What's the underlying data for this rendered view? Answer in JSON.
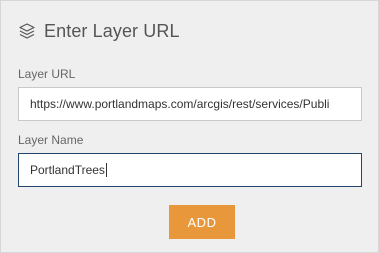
{
  "header": {
    "title": "Enter Layer URL",
    "icon": "layers-icon"
  },
  "form": {
    "url_label": "Layer URL",
    "url_value": "https://www.portlandmaps.com/arcgis/rest/services/Publi",
    "name_label": "Layer Name",
    "name_value": "PortlandTrees"
  },
  "actions": {
    "add_label": "ADD"
  },
  "colors": {
    "accent": "#e8983a",
    "background": "#efefef",
    "focus_border": "#23446b"
  }
}
